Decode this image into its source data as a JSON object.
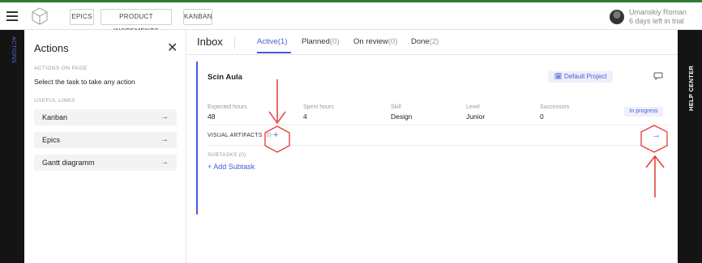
{
  "topbar": {
    "nav": [
      "EPICS",
      "PRODUCT INCREMENTS",
      "KANBAN"
    ],
    "user_name": "Umanskiy Roman",
    "trial_text": "6 days left in trial"
  },
  "left_rail": {
    "label": "ACTIONS"
  },
  "right_rail": {
    "label": "HELP CENTER"
  },
  "actions_panel": {
    "title": "Actions",
    "actions_on_page_label": "ACTIONS ON PAGE",
    "hint": "Select the task to take any action",
    "useful_links_label": "USEFUL LINKS",
    "links": [
      "Kanban",
      "Epics",
      "Gantt diagramm"
    ],
    "link_arrow": "→"
  },
  "main": {
    "title": "Inbox",
    "tabs": [
      {
        "label": "Active",
        "count": "(1)",
        "active": true
      },
      {
        "label": "Planned",
        "count": "(0)",
        "active": false
      },
      {
        "label": "On review",
        "count": "(0)",
        "active": false
      },
      {
        "label": "Done",
        "count": "(2)",
        "active": false
      }
    ]
  },
  "task": {
    "title": "Scin Aula",
    "project": "🗓 Default Project",
    "fields": [
      {
        "label": "Expected hours",
        "value": "48"
      },
      {
        "label": "Spent hours",
        "value": "4"
      },
      {
        "label": "Skill",
        "value": "Design"
      },
      {
        "label": "Level",
        "value": "Junior"
      },
      {
        "label": "Successors",
        "value": "0"
      }
    ],
    "status": "In progress",
    "visual_artifacts_label": "VISUAL ARTIFACTS",
    "visual_artifacts_count": "(0)",
    "add_icon": "+",
    "go_icon": "→",
    "subtasks_label": "SUBTASKS (0)",
    "add_subtask": "+ Add Subtask"
  },
  "colors": {
    "accent": "#4a5ad8",
    "topbar_border": "#2e7d32",
    "rail": "#141414",
    "annotation": "#e53935"
  }
}
